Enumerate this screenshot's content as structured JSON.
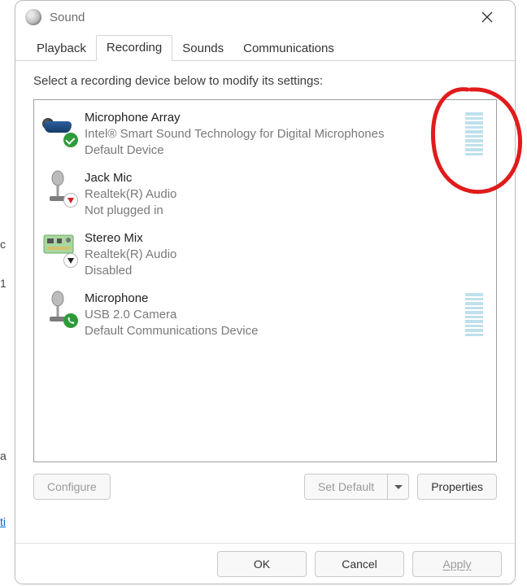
{
  "window": {
    "title": "Sound"
  },
  "tabs": [
    {
      "label": "Playback",
      "active": false
    },
    {
      "label": "Recording",
      "active": true
    },
    {
      "label": "Sounds",
      "active": false
    },
    {
      "label": "Communications",
      "active": false
    }
  ],
  "instruction": "Select a recording device below to modify its settings:",
  "devices": [
    {
      "name": "Microphone Array",
      "driver": "Intel® Smart Sound Technology for Digital Microphones",
      "status": "Default Device",
      "icon": "headset",
      "badge": "check-green",
      "meter": true
    },
    {
      "name": "Jack Mic",
      "driver": "Realtek(R) Audio",
      "status": "Not plugged in",
      "icon": "micstand",
      "badge": "arrow-red",
      "meter": false
    },
    {
      "name": "Stereo Mix",
      "driver": "Realtek(R) Audio",
      "status": "Disabled",
      "icon": "chipboard",
      "badge": "arrow-black",
      "meter": false
    },
    {
      "name": "Microphone",
      "driver": "USB 2.0 Camera",
      "status": "Default Communications Device",
      "icon": "micstand",
      "badge": "phone-green",
      "meter": true
    }
  ],
  "buttons": {
    "configure": "Configure",
    "setdefault": "Set Default",
    "properties": "Properties",
    "ok": "OK",
    "cancel": "Cancel",
    "apply": "Apply"
  }
}
